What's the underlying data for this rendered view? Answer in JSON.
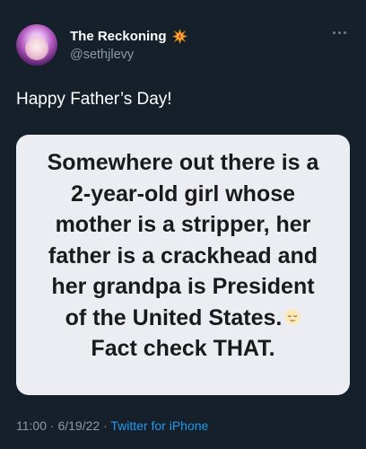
{
  "author": {
    "display_name": "The Reckoning",
    "handle": "@sethjlevy",
    "badge_icon": "collision-emoji-icon",
    "avatar_icon": "profile-avatar"
  },
  "more_icon": "more-options-icon",
  "tweet": {
    "text": "Happy Father’s Day!"
  },
  "media": {
    "lines": [
      "Somewhere out there is a",
      "2-year-old girl whose",
      "mother is a stripper, her",
      "father is a crackhead and",
      "her grandpa is President",
      "of the United States.",
      "Fact check THAT."
    ],
    "emoji_icon": "relieved-face-icon",
    "background": "#ececf3"
  },
  "meta": {
    "time": "11:00",
    "separator": " · ",
    "date": "6/19/22",
    "source": "Twitter for iPhone"
  },
  "colors": {
    "background": "#15202b",
    "secondary_text": "#8b98a5",
    "link": "#1d9bf0"
  }
}
